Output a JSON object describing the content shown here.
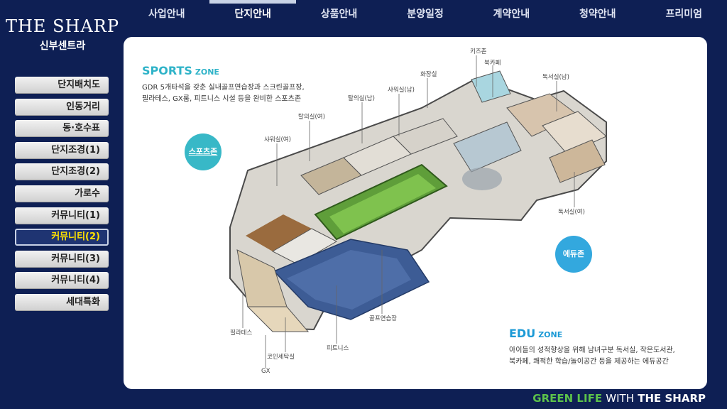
{
  "logo": {
    "brand": "THE SHARP",
    "sub": "신부센트라"
  },
  "topnav": [
    "사업안내",
    "단지안내",
    "상품안내",
    "분양일정",
    "계약안내",
    "청약안내",
    "프리미엄"
  ],
  "sidenav": [
    "단지배치도",
    "인동거리",
    "동·호수표",
    "단지조경(1)",
    "단지조경(2)",
    "가로수",
    "커뮤니티(1)",
    "커뮤니티(2)",
    "커뮤니티(3)",
    "커뮤니티(4)",
    "세대특화"
  ],
  "sports": {
    "title": "SPORTS",
    "title_small": "ZONE",
    "desc1": "GDR 5개타석을 갖춘 실내골프연습장과 스크린골프장,",
    "desc2": "필라테스, GX룸, 피트니스 시설 등을 완비한 스포츠존",
    "badge": "스포츠존"
  },
  "edu": {
    "title": "EDU",
    "title_small": "ZONE",
    "desc1": "아이들의 성적향상을 위해 남녀구분 독서실, 작은도서관,",
    "desc2": "북카페, 쾌적한 학습/놀이공간 등을 제공하는 에듀공간",
    "badge": "에듀존"
  },
  "labels": {
    "kids": "키즈존",
    "bookcafe": "북카페",
    "restroom": "화장실",
    "study_m": "독서실(남)",
    "shower_m": "샤워실(남)",
    "locker_m": "탈의실(남)",
    "locker_f": "탈의실(여)",
    "shower_f": "샤워실(여)",
    "study_f": "독서실(여)",
    "golf": "골프연습장",
    "fitness": "피트니스",
    "coin": "코인세탁실",
    "pilates": "필라테스",
    "gx": "GX"
  },
  "footer": {
    "green": "GREEN LIFE",
    "with": "WITH",
    "sharp": "THE SHARP"
  }
}
